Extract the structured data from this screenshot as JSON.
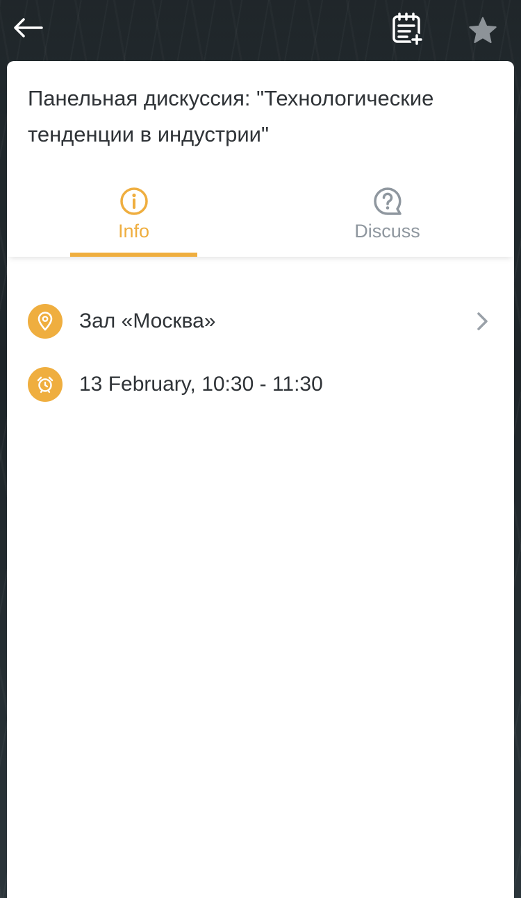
{
  "header": {
    "back_icon": "arrow-left-icon",
    "calendar_add_icon": "calendar-add-icon",
    "favorite_icon": "star-icon"
  },
  "event": {
    "title": "Панельная дискуссия: \"Технологические тенденции в индустрии\""
  },
  "tabs": [
    {
      "label": "Info",
      "icon": "info-icon",
      "active": true
    },
    {
      "label": "Discuss",
      "icon": "question-bubble-icon",
      "active": false
    }
  ],
  "details": {
    "location": {
      "icon": "location-pin-icon",
      "text": "Зал «Москва»"
    },
    "time": {
      "icon": "alarm-clock-icon",
      "text": "13 February, 10:30 - 11:30"
    }
  },
  "colors": {
    "accent": "#efae3f",
    "inactive": "#8f979f",
    "text": "#2f3337"
  }
}
